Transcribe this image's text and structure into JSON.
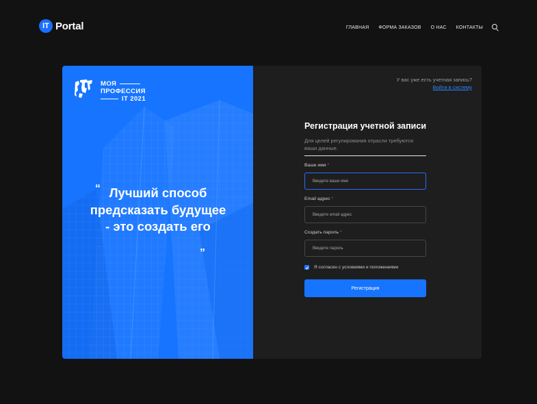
{
  "header": {
    "logo_badge": "IT",
    "logo_text": "Portal",
    "nav": [
      "ГЛАВНАЯ",
      "ФОРМА ЗАКАЗОВ",
      "О НАС",
      "КОНТАКТЫ"
    ],
    "search_icon": "search-icon"
  },
  "promo": {
    "brand_line1": "МОЯ",
    "brand_line2": "ПРОФЕССИЯ",
    "brand_line3": "IT 2021",
    "quote": "Лучший способ предсказать будущее - это создать его",
    "quote_open": "“",
    "quote_close": "”",
    "accent_color": "#1674ff"
  },
  "auth": {
    "have_account": "У вас уже есть учетная запись?",
    "login_link": "Войти в систему"
  },
  "form": {
    "title": "Регистрация учетной записи",
    "subtitle": "Для целей регулирования отрасли требуются ваши данные.",
    "name_label": "Ваше имя",
    "name_placeholder": "Введите ваше имя",
    "email_label": "Email адрес",
    "email_placeholder": "Введите email адрес",
    "password_label": "Создать пароль",
    "password_placeholder": "Введите пароль",
    "required_mark": "*",
    "agree_label": "Я согласен с условиями и положениями",
    "agree_checked": true,
    "submit_label": "Регистрация"
  }
}
